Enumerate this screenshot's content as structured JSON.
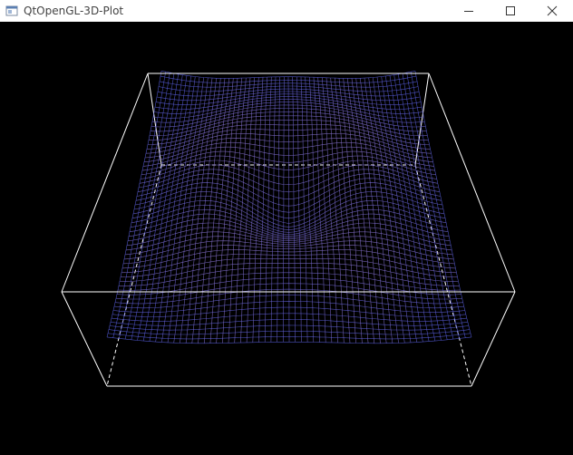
{
  "window": {
    "title": "QtOpenGL-3D-Plot",
    "icon": "app-window-icon",
    "controls": [
      "minimize-icon",
      "maximize-icon",
      "close-icon"
    ]
  },
  "plot": {
    "background": "#000000",
    "box_color": "#ffffff",
    "mesh_colors": {
      "low": "#2a6bff",
      "mid": "#5a5cd8",
      "high": "#f0a0a8"
    }
  }
}
